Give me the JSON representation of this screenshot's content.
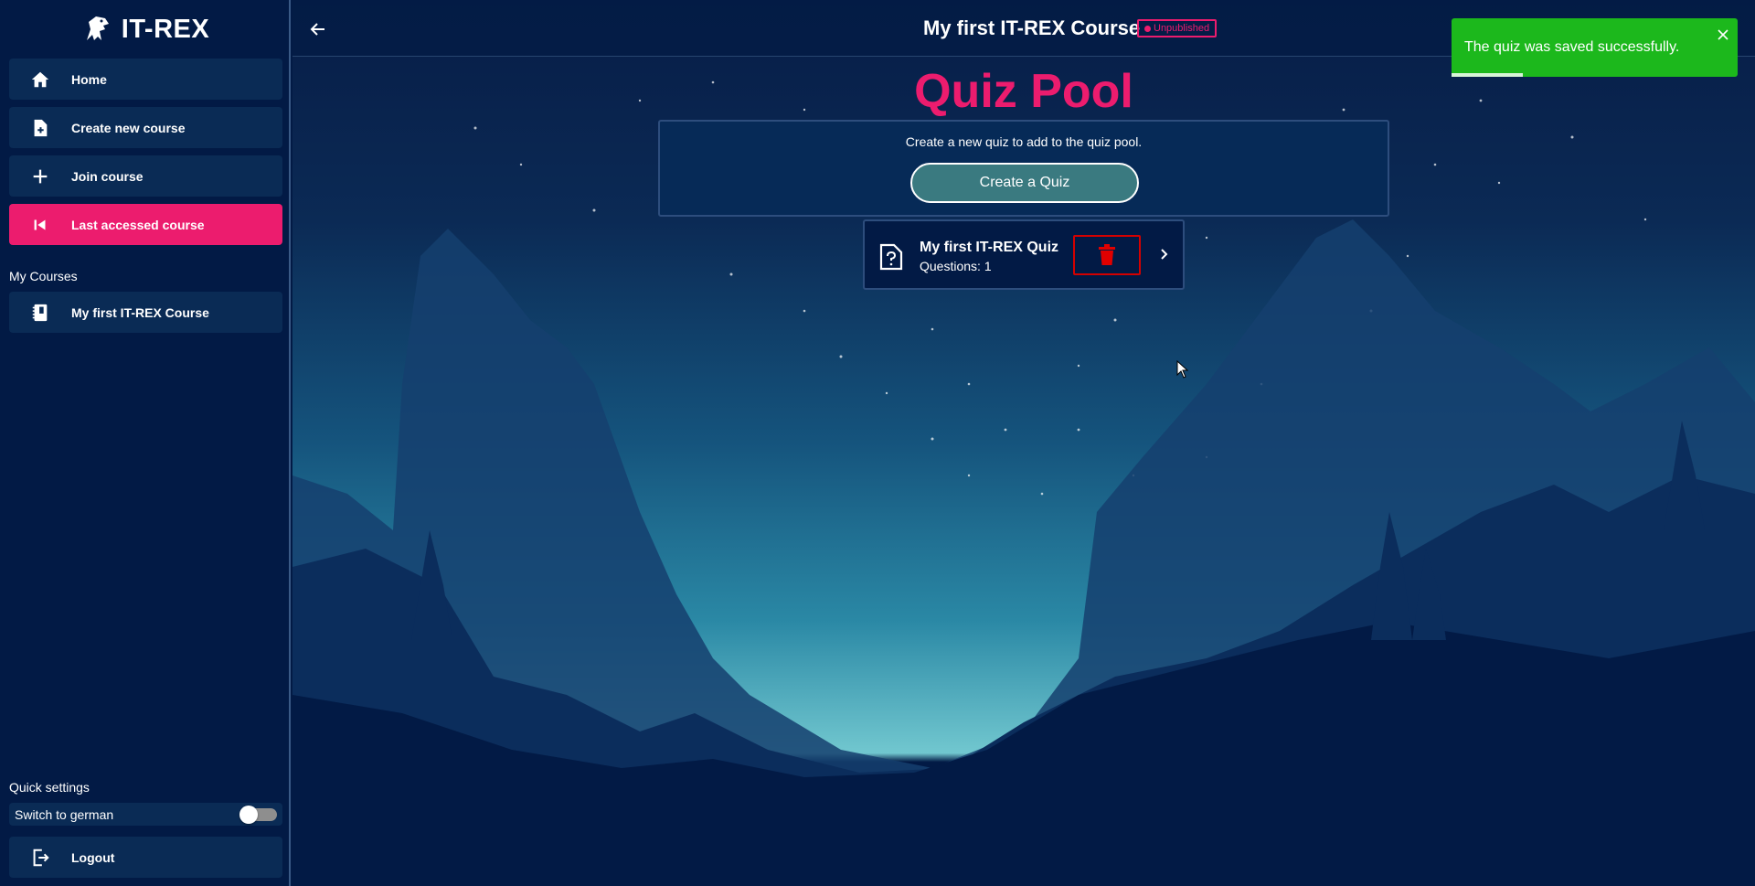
{
  "app": {
    "name": "IT-REX"
  },
  "sidebar": {
    "nav": [
      {
        "label": "Home",
        "icon": "home-icon"
      },
      {
        "label": "Create new course",
        "icon": "file-plus-icon"
      },
      {
        "label": "Join course",
        "icon": "plus-icon"
      },
      {
        "label": "Last accessed course",
        "icon": "skip-back-icon",
        "active": true
      }
    ],
    "my_courses_label": "My Courses",
    "courses": [
      {
        "label": "My first IT-REX Course",
        "icon": "notebook-icon"
      }
    ],
    "quick_settings_label": "Quick settings",
    "language_toggle": {
      "label": "Switch to german",
      "on": false
    },
    "logout_label": "Logout"
  },
  "header": {
    "course_title": "My first IT-REX Course",
    "status_badge": "Unpublished"
  },
  "main": {
    "page_title": "Quiz Pool",
    "create_prompt": "Create a new quiz to add to the quiz pool.",
    "create_button": "Create a Quiz",
    "quizzes": [
      {
        "title": "My first IT-REX Quiz",
        "subtitle": "Questions: 1"
      }
    ]
  },
  "toast": {
    "message": "The quiz was saved successfully.",
    "progress": 0.25
  },
  "colors": {
    "accent": "#ec1c6e",
    "success": "#1cb81c",
    "danger": "#d40000",
    "background": "#021a45"
  }
}
